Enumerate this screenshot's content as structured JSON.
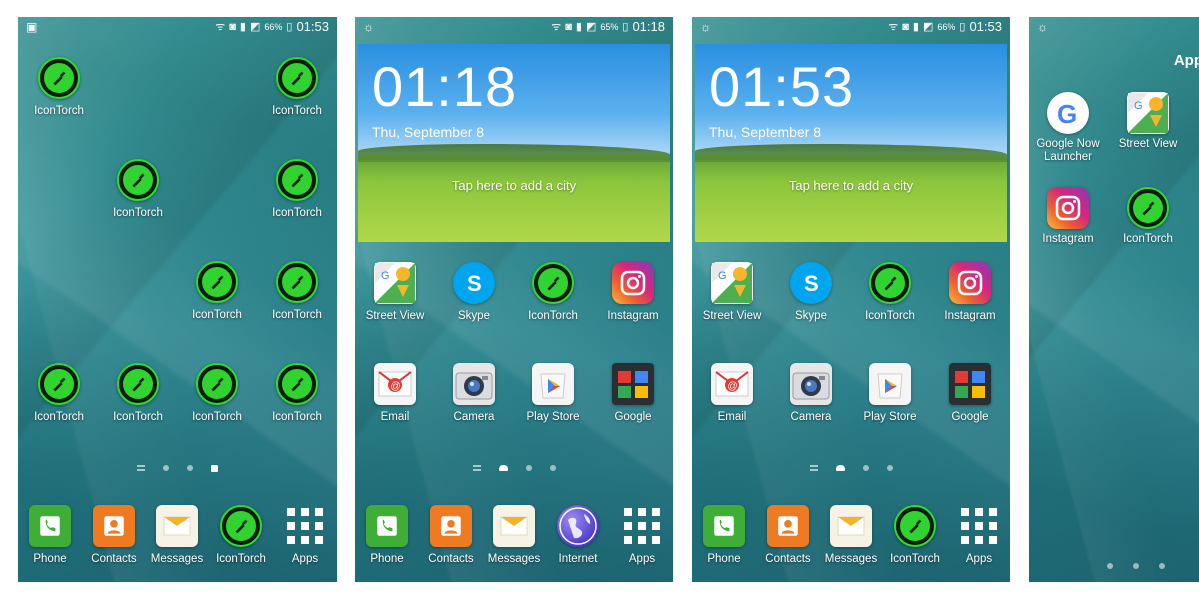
{
  "screens": [
    {
      "status": {
        "battery": "66%",
        "time": "01:53"
      },
      "icons": [
        "IconTorch",
        "IconTorch",
        "IconTorch",
        "IconTorch",
        "IconTorch",
        "IconTorch",
        "IconTorch",
        "IconTorch",
        "IconTorch",
        "IconTorch"
      ],
      "dock": [
        "Phone",
        "Contacts",
        "Messages",
        "IconTorch",
        "Apps"
      ]
    },
    {
      "status": {
        "battery": "65%",
        "time": "01:18"
      },
      "widget": {
        "time": "01:18",
        "date": "Thu, September 8",
        "city_prompt": "Tap here to add a city"
      },
      "icons": [
        "Street View",
        "Skype",
        "IconTorch",
        "Instagram",
        "Email",
        "Camera",
        "Play Store",
        "Google"
      ],
      "dock": [
        "Phone",
        "Contacts",
        "Messages",
        "Internet",
        "Apps"
      ]
    },
    {
      "status": {
        "battery": "66%",
        "time": "01:53"
      },
      "widget": {
        "time": "01:53",
        "date": "Thu, September 8",
        "city_prompt": "Tap here to add a city"
      },
      "icons": [
        "Street View",
        "Skype",
        "IconTorch",
        "Instagram",
        "Email",
        "Camera",
        "Play Store",
        "Google"
      ],
      "dock": [
        "Phone",
        "Contacts",
        "Messages",
        "IconTorch",
        "Apps"
      ]
    },
    {
      "edge_label": "App",
      "icons": [
        "Google Now Launcher",
        "Street View",
        "Instagram",
        "IconTorch"
      ]
    }
  ],
  "icon_types": {
    "torch": "flashlight-icon",
    "phone": "phone-icon",
    "contacts": "contacts-icon",
    "messages": "messages-icon",
    "apps": "apps-grid-icon"
  },
  "colors": {
    "accent_green": "#31d330",
    "wallpaper": "#2e8f95"
  }
}
